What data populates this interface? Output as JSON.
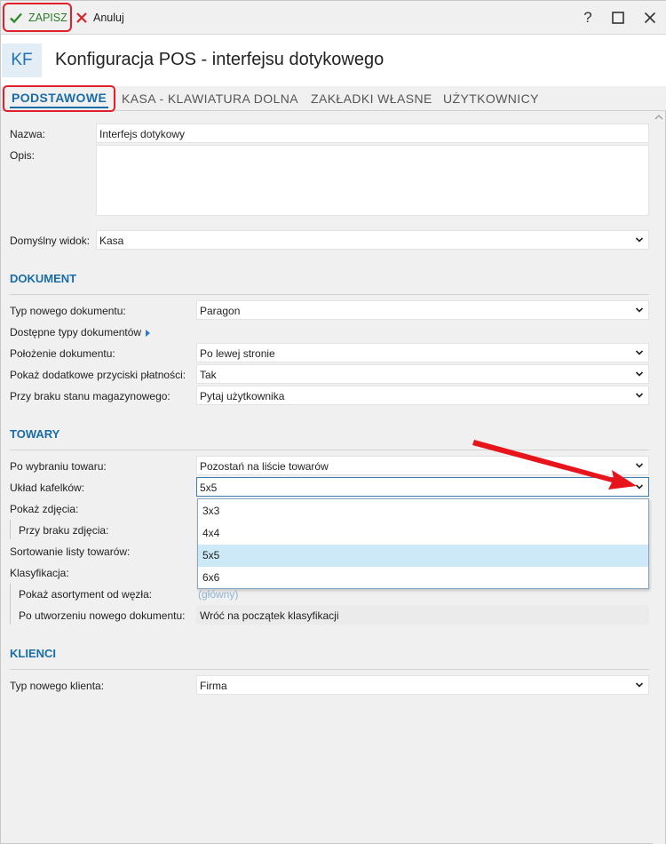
{
  "toolbar": {
    "save_label": "ZAPISZ",
    "cancel_label": "Anuluj",
    "help": "?",
    "maximize": "☐",
    "close": "✕"
  },
  "header": {
    "badge": "KF",
    "title": "Konfiguracja POS - interfejsu dotykowego"
  },
  "tabs": [
    {
      "label": "PODSTAWOWE",
      "active": true
    },
    {
      "label": "KASA - KLAWIATURA DOLNA"
    },
    {
      "label": "ZAKŁADKI WŁASNE"
    },
    {
      "label": "UŻYTKOWNICY"
    }
  ],
  "general": {
    "name_label": "Nazwa:",
    "name_value": "Interfejs dotykowy",
    "desc_label": "Opis:",
    "desc_value": "",
    "default_view_label": "Domyślny widok:",
    "default_view_value": "Kasa"
  },
  "dokument": {
    "section_title": "DOKUMENT",
    "new_doc_type_label": "Typ nowego dokumentu:",
    "new_doc_type_value": "Paragon",
    "available_types_label": "Dostępne typy dokumentów",
    "doc_position_label": "Położenie dokumentu:",
    "doc_position_value": "Po lewej stronie",
    "extra_payment_label": "Pokaż dodatkowe przyciski płatności:",
    "extra_payment_value": "Tak",
    "no_stock_label": "Przy braku stanu magazynowego:",
    "no_stock_value": "Pytaj użytkownika"
  },
  "towary": {
    "section_title": "TOWARY",
    "after_select_label": "Po wybraniu towaru:",
    "after_select_value": "Pozostań na liście towarów",
    "tiles_label": "Układ kafelków:",
    "tiles_value": "5x5",
    "tiles_options": [
      "3x3",
      "4x4",
      "5x5",
      "6x6"
    ],
    "tiles_selected_index": 2,
    "show_image_label": "Pokaż zdjęcia:",
    "no_image_label": "Przy braku zdjęcia:",
    "sort_label": "Sortowanie listy towarów:",
    "classification_label": "Klasyfikacja:",
    "show_assortment_label": "Pokaż asortyment od węzła:",
    "show_assortment_value": "(główny)",
    "after_new_doc_label": "Po utworzeniu nowego dokumentu:",
    "after_new_doc_value": "Wróć na początek klasyfikacji"
  },
  "klienci": {
    "section_title": "KLIENCI",
    "new_client_type_label": "Typ nowego klienta:",
    "new_client_type_value": "Firma"
  },
  "colors": {
    "accent": "#1a6ca8",
    "highlight_border": "#e0202a",
    "annotation_arrow": "#e8141c",
    "selection": "#cde8f6"
  }
}
